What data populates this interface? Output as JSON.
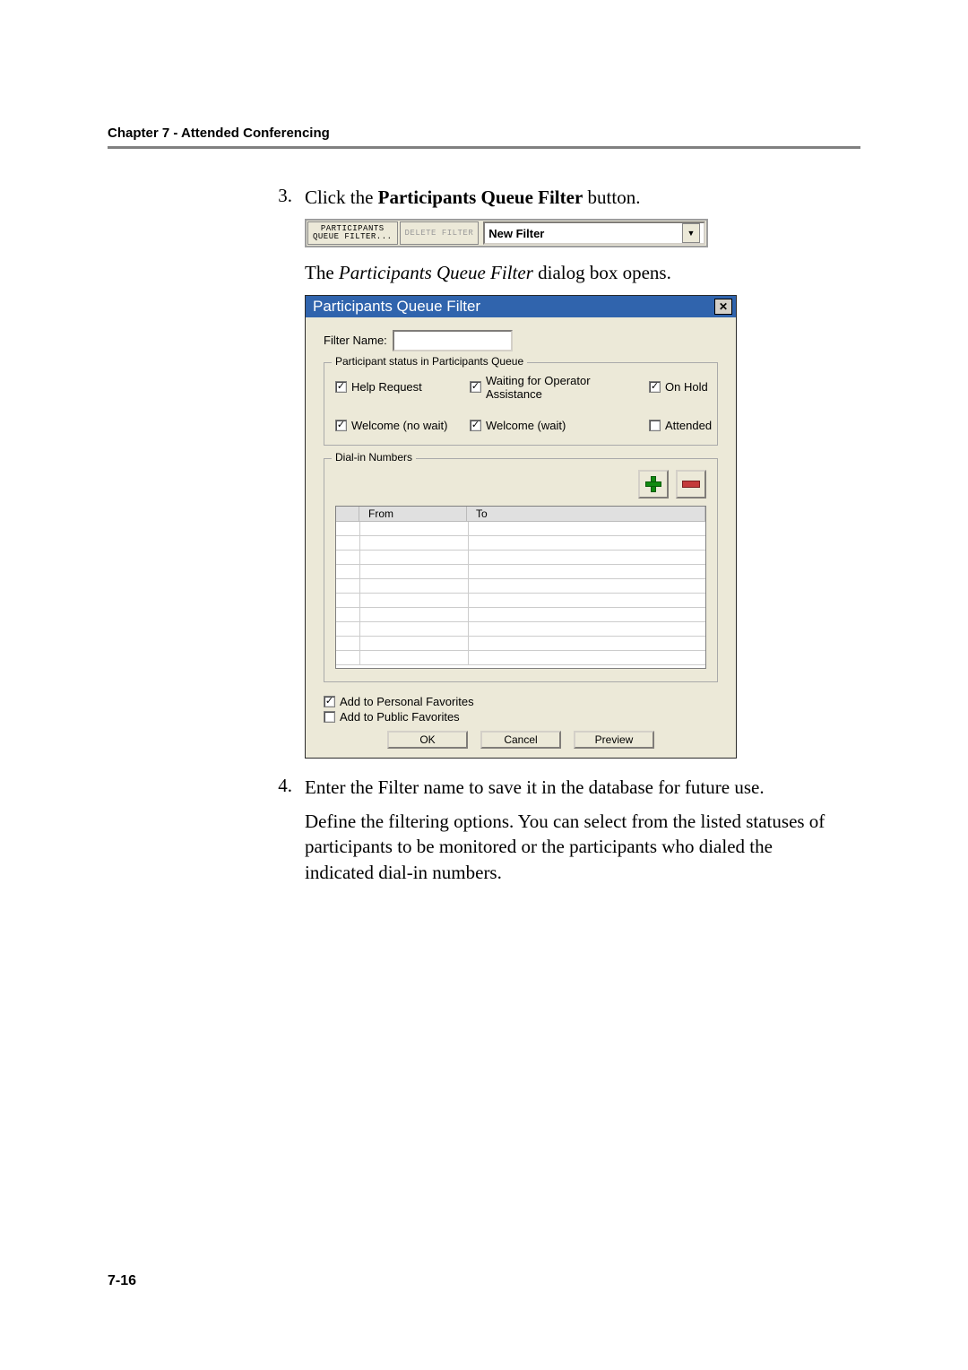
{
  "header": {
    "chapter_title": "Chapter 7 - Attended Conferencing"
  },
  "steps": {
    "three": {
      "num": "3.",
      "text_prefix": "Click the ",
      "text_bold": "Participants Queue Filter",
      "text_suffix": " button.",
      "caption_prefix": "The ",
      "caption_italic": "Participants Queue Filter",
      "caption_suffix": " dialog box opens."
    },
    "four": {
      "num": "4.",
      "line1": "Enter the Filter name to save it in the database for future use.",
      "line2": "Define the filtering options. You can select from the listed statuses of participants to be monitored or the participants who dialed the indicated dial-in numbers."
    }
  },
  "toolbar": {
    "btn1_line1": "PARTICIPANTS",
    "btn1_line2": "QUEUE FILTER...",
    "btn2": "DELETE FILTER",
    "select_value": "New Filter",
    "dropdown_glyph": "▼"
  },
  "dialog": {
    "title": "Participants Queue Filter",
    "close_glyph": "✕",
    "filter_name_label": "Filter Name:",
    "group_status_legend": "Participant status in Participants Queue",
    "chk_help_request": "Help Request",
    "chk_waiting": "Waiting for Operator Assistance",
    "chk_on_hold": "On Hold",
    "chk_welcome_nowait": "Welcome (no wait)",
    "chk_welcome_wait": "Welcome (wait)",
    "chk_attended": "Attended",
    "group_dialin_legend": "Dial-in Numbers",
    "col_from": "From",
    "col_to": "To",
    "chk_personal_fav": "Add to Personal Favorites",
    "chk_public_fav": "Add to Public Favorites",
    "btn_ok": "OK",
    "btn_cancel": "Cancel",
    "btn_preview": "Preview"
  },
  "checkmarks": {
    "checked": "✓",
    "unchecked": ""
  },
  "footer": {
    "page_number": "7-16"
  }
}
